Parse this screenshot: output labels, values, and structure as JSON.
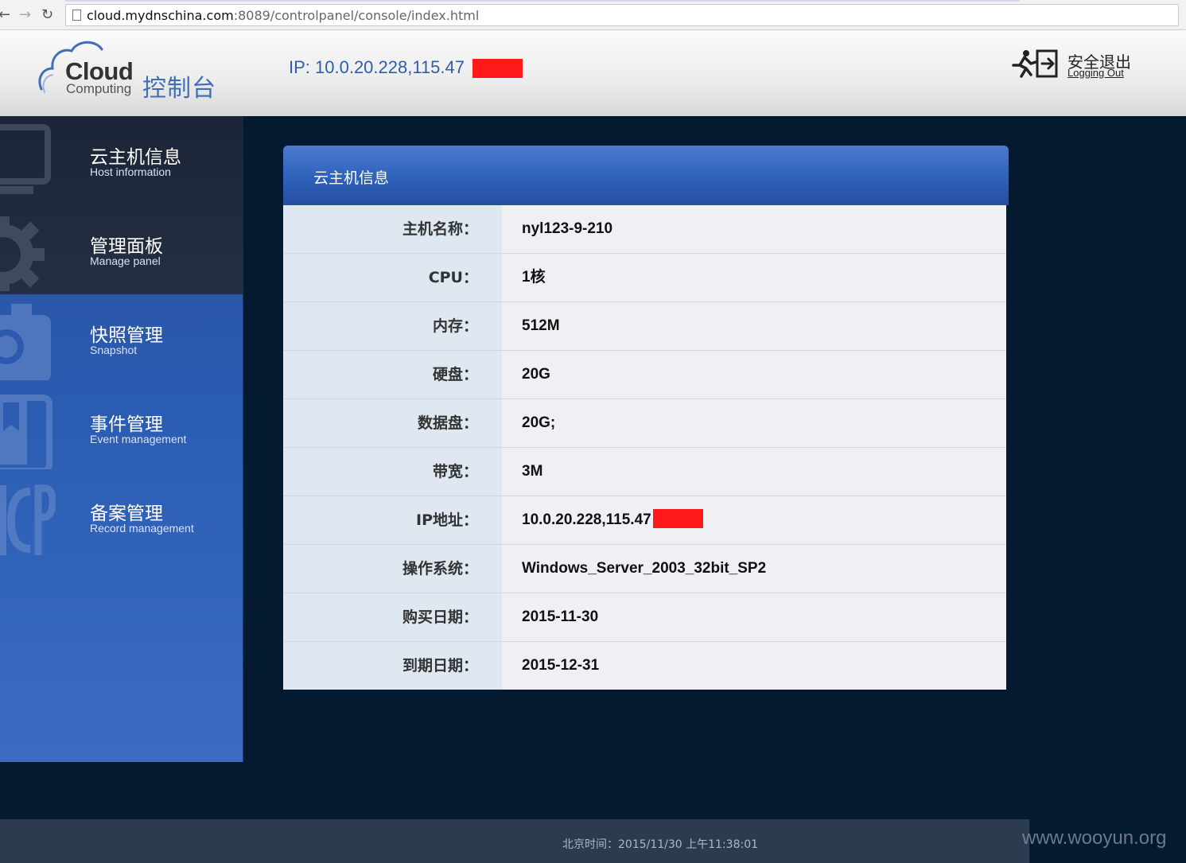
{
  "browser": {
    "url_host": "cloud.mydnschina.com",
    "url_path": ":8089/controlpanel/console/index.html"
  },
  "header": {
    "logo_cloud": "Cloud",
    "logo_computing": "Computing",
    "logo_console": "控制台",
    "ip_label": "IP: 10.0.20.228,115.47",
    "logout_cn": "安全退出",
    "logout_en": "Logging Out"
  },
  "sidebar": {
    "items": [
      {
        "cn": "云主机信息",
        "en": "Host information",
        "icon": "monitor-icon"
      },
      {
        "cn": "管理面板",
        "en": "Manage panel",
        "icon": "gear-icon"
      },
      {
        "cn": "快照管理",
        "en": "Snapshot",
        "icon": "camera-icon"
      },
      {
        "cn": "事件管理",
        "en": "Event management",
        "icon": "book-icon"
      },
      {
        "cn": "备案管理",
        "en": "Record management",
        "icon": "icp-icon"
      }
    ]
  },
  "panel": {
    "title": "云主机信息",
    "rows": [
      {
        "label": "主机名称：",
        "value": "nyl123-9-210"
      },
      {
        "label": "CPU：",
        "value": "1核"
      },
      {
        "label": "内存：",
        "value": "512M"
      },
      {
        "label": "硬盘：",
        "value": "20G"
      },
      {
        "label": "数据盘：",
        "value": "20G;"
      },
      {
        "label": "带宽：",
        "value": "3M"
      },
      {
        "label": "IP地址：",
        "value": "10.0.20.228,115.47"
      },
      {
        "label": "操作系统：",
        "value": "Windows_Server_2003_32bit_SP2"
      },
      {
        "label": "购买日期：",
        "value": "2015-11-30"
      },
      {
        "label": "到期日期：",
        "value": "2015-12-31"
      }
    ]
  },
  "footer": {
    "time": "北京时间：2015/11/30 上午11:38:01"
  },
  "watermark": "www.wooyun.org",
  "colors": {
    "redaction": "#ff1a1a",
    "accent_blue": "#2f5fa8"
  }
}
